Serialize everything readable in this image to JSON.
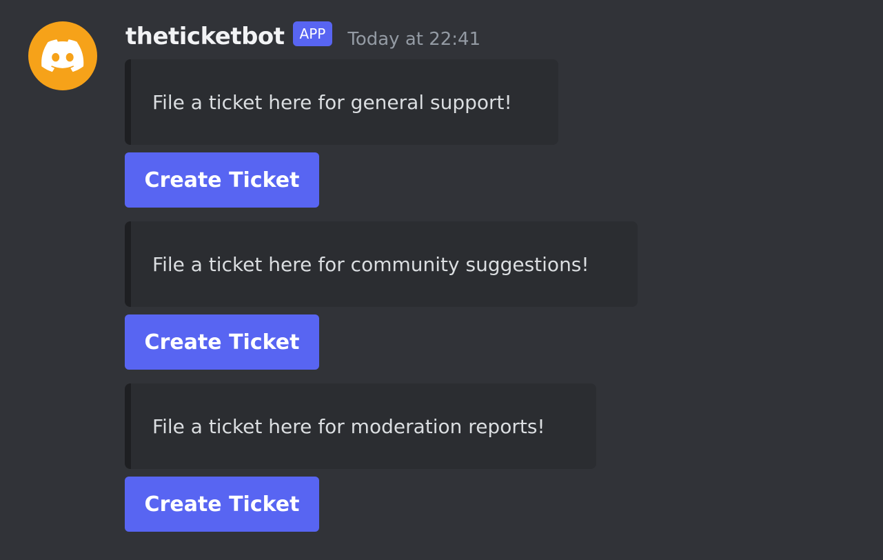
{
  "message": {
    "author": "theticketbot",
    "badge": "APP",
    "timestamp": "Today at 22:41",
    "avatar_icon": "discord-logo-icon",
    "avatar_color": "#f6a219"
  },
  "tickets": [
    {
      "embed_text": "File a ticket here for general support!",
      "button_label": "Create Ticket"
    },
    {
      "embed_text": "File a ticket here for community suggestions!",
      "button_label": "Create Ticket"
    },
    {
      "embed_text": "File a ticket here for moderation reports!",
      "button_label": "Create Ticket"
    }
  ],
  "colors": {
    "background": "#313338",
    "embed_background": "#2b2d31",
    "button": "#5865f2",
    "badge": "#5865f2",
    "timestamp": "#949ba4"
  }
}
